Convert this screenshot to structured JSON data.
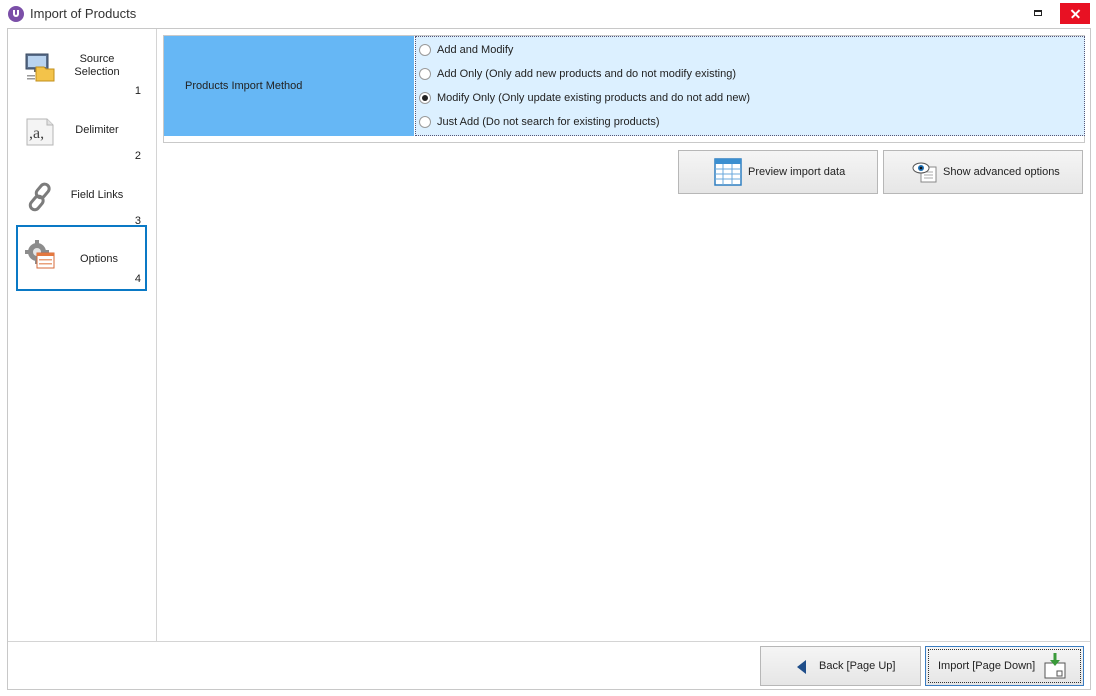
{
  "window": {
    "title": "Import of Products",
    "accent_color": "#0a79c5",
    "close_color": "#e81123"
  },
  "steps": [
    {
      "label": "Source Selection",
      "number": "1",
      "icon": "source-selection-icon"
    },
    {
      "label": "Delimiter",
      "number": "2",
      "icon": "delimiter-icon"
    },
    {
      "label": "Field Links",
      "number": "3",
      "icon": "link-icon"
    },
    {
      "label": "Options",
      "number": "4",
      "icon": "options-icon",
      "active": true
    }
  ],
  "import_method": {
    "label": "Products Import Method",
    "label_bg": "#66b7f5",
    "options_bg": "#dcf0ff",
    "selected": "Modify Only (Only update existing products and do not add new)",
    "options": [
      "Add and Modify",
      "Add Only (Only add new products and do not modify existing)",
      "Modify Only (Only update existing products and do not add new)",
      "Just Add (Do not search for existing products)"
    ]
  },
  "actions": {
    "preview": "Preview import data",
    "advanced": "Show advanced options"
  },
  "footer": {
    "back": "Back [Page Up]",
    "import": "Import [Page Down]"
  }
}
